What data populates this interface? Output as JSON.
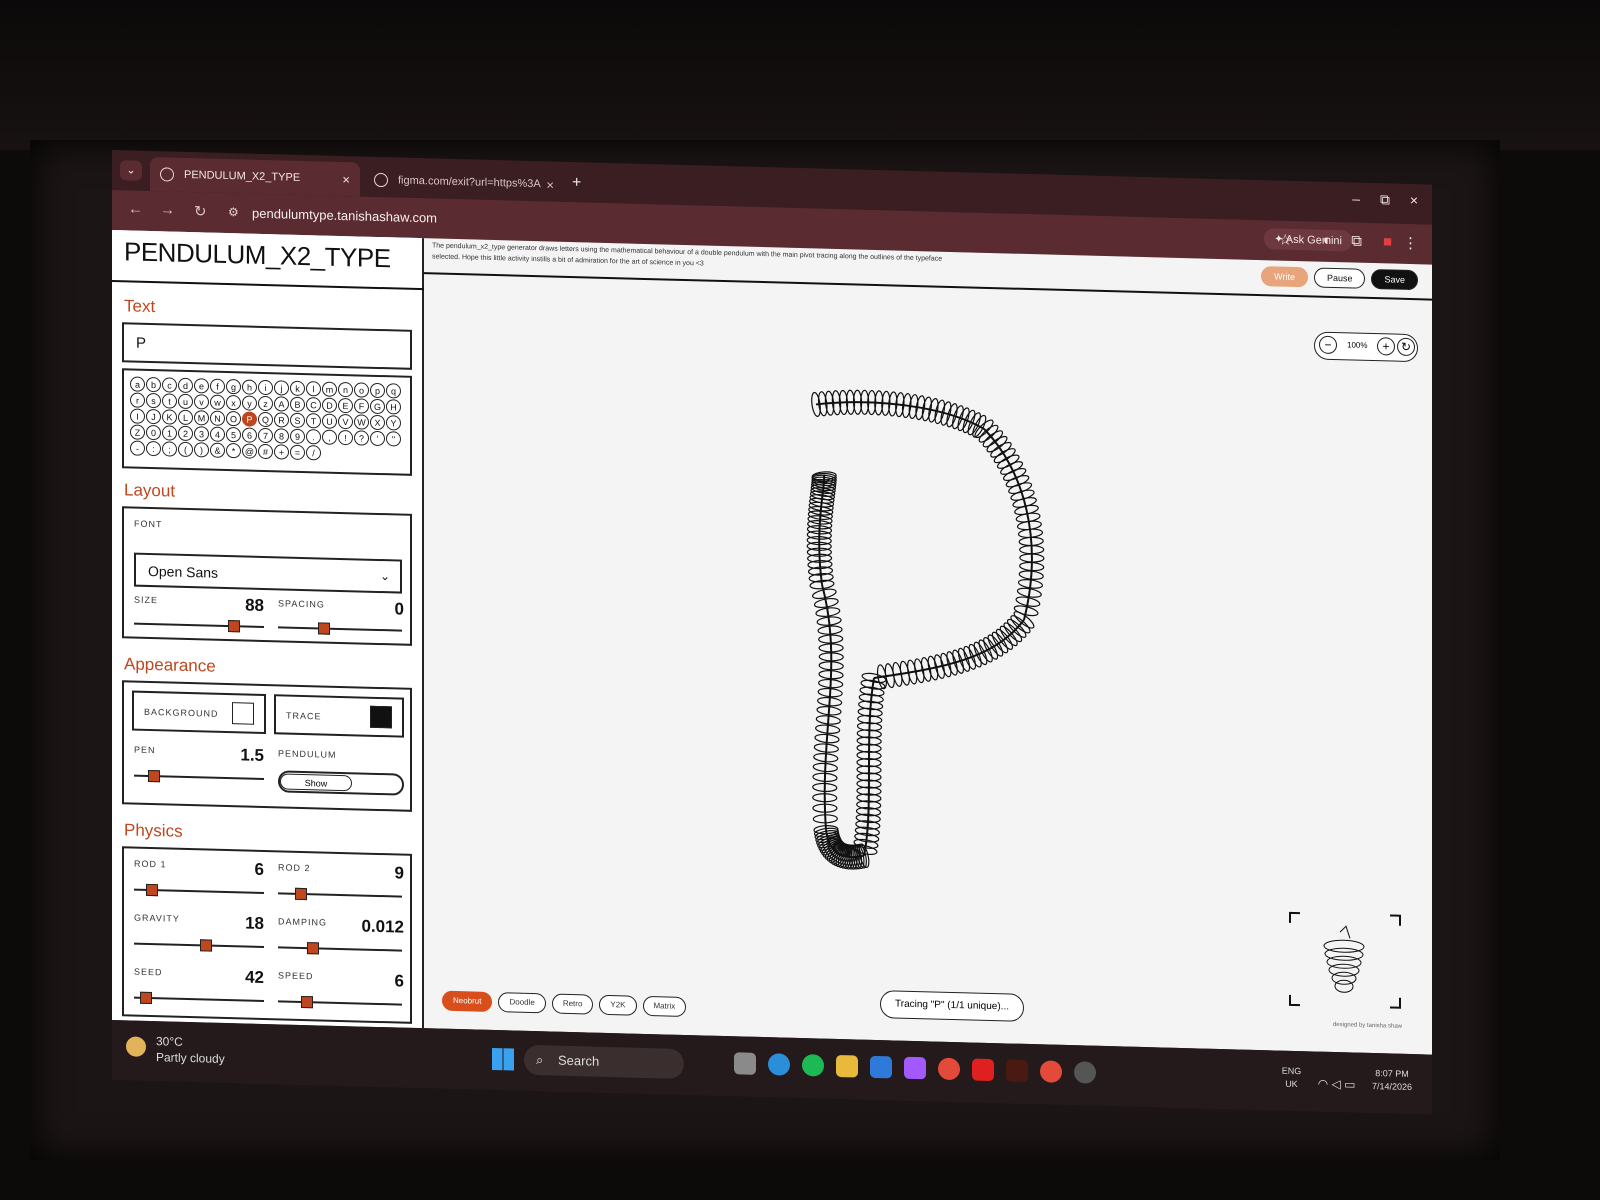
{
  "browser": {
    "tabs": [
      {
        "title": "PENDULUM_X2_TYPE",
        "close": "×"
      },
      {
        "title": "figma.com/exit?url=https%3A",
        "close": "×"
      }
    ],
    "new_tab": "+",
    "url": "pendulumtype.tanishashaw.com",
    "ask_gemini": "Ask Gemini",
    "win_minimize": "–",
    "win_restore": "⧉",
    "win_close": "×"
  },
  "app": {
    "brand": "PENDULUM_X2_TYPE",
    "description": "The pendulum_x2_type generator draws letters using the mathematical behaviour of a double pendulum with the main pivot tracing along the outlines of the typeface selected. Hope this little activity instills a bit of admiration for the art of science in you <3",
    "actions": {
      "write": "Write",
      "pause": "Pause",
      "save": "Save"
    },
    "zoom": "100%"
  },
  "sidebar": {
    "text_section": "Text",
    "text_value": "P",
    "glyphs": [
      "a",
      "b",
      "c",
      "d",
      "e",
      "f",
      "g",
      "h",
      "i",
      "j",
      "k",
      "l",
      "m",
      "n",
      "o",
      "p",
      "q",
      "r",
      "s",
      "t",
      "u",
      "v",
      "w",
      "x",
      "y",
      "z",
      "A",
      "B",
      "C",
      "D",
      "E",
      "F",
      "G",
      "H",
      "I",
      "J",
      "K",
      "L",
      "M",
      "N",
      "O",
      "P",
      "Q",
      "R",
      "S",
      "T",
      "U",
      "V",
      "W",
      "X",
      "Y",
      "Z",
      "0",
      "1",
      "2",
      "3",
      "4",
      "5",
      "6",
      "7",
      "8",
      "9",
      ".",
      ",",
      "!",
      "?",
      "'",
      "\"",
      "-",
      ":",
      ";",
      "(",
      ")",
      "&",
      "*",
      "@",
      "#",
      "+",
      "=",
      "/"
    ],
    "selected_glyph": "P",
    "layout_section": "Layout",
    "font_label": "FONT",
    "font_value": "Open Sans",
    "size_label": "SIZE",
    "size_value": "88",
    "size_fraction": 0.78,
    "spacing_label": "SPACING",
    "spacing_value": "0",
    "spacing_fraction": 0.35,
    "appearance_section": "Appearance",
    "background_label": "BACKGROUND",
    "background_color": "#ffffff",
    "trace_label": "TRACE",
    "trace_color": "#111111",
    "pen_label": "PEN",
    "pen_value": "1.5",
    "pen_fraction": 0.12,
    "pendulum_label": "PENDULUM",
    "pendulum_toggle": "Show",
    "physics_section": "Physics",
    "rod1_label": "ROD 1",
    "rod1_value": "6",
    "rod1_fraction": 0.1,
    "rod2_label": "ROD 2",
    "rod2_value": "9",
    "rod2_fraction": 0.15,
    "gravity_label": "GRAVITY",
    "gravity_value": "18",
    "gravity_fraction": 0.55,
    "damping_label": "DAMPING",
    "damping_value": "0.012",
    "damping_fraction": 0.25,
    "seed_label": "SEED",
    "seed_value": "42",
    "seed_fraction": 0.05,
    "speed_label": "SPEED",
    "speed_value": "6",
    "speed_fraction": 0.2
  },
  "canvas": {
    "themes": [
      "Neobrut",
      "Doodle",
      "Retro",
      "Y2K",
      "Matrix"
    ],
    "active_theme": "Neobrut",
    "status": "Tracing \"P\" (1/1 unique)...",
    "credit": "designed by tanisha shaw"
  },
  "taskbar": {
    "temperature": "30°C",
    "weather": "Partly cloudy",
    "search": "Search",
    "lang": "ENG",
    "region": "UK",
    "time": "8:07 PM",
    "date": "7/14/2026"
  },
  "colors": {
    "accent": "#c0461d",
    "chrome": "#5a2b31"
  }
}
